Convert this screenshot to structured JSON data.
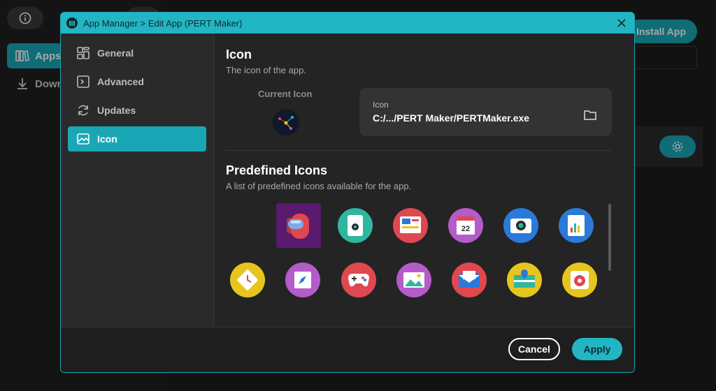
{
  "background": {
    "sidebar": [
      {
        "label": "Apps",
        "icon": "apps-icon",
        "active": true
      },
      {
        "label": "Downloads",
        "icon": "download-icon",
        "active": false
      }
    ],
    "install_label": "Install App"
  },
  "dialog": {
    "title": "App Manager > Edit App (PERT Maker)",
    "nav": [
      {
        "label": "General",
        "icon": "grid-icon",
        "active": false
      },
      {
        "label": "Advanced",
        "icon": "terminal-icon",
        "active": false
      },
      {
        "label": "Updates",
        "icon": "refresh-icon",
        "active": false
      },
      {
        "label": "Icon",
        "icon": "image-icon",
        "active": true
      }
    ],
    "icon_section": {
      "title": "Icon",
      "subtitle": "The icon of the app.",
      "current_label": "Current Icon",
      "current_icon_text": "PERT Maker",
      "field_label": "Icon",
      "field_value": "C:/.../PERT Maker/PERTMaker.exe"
    },
    "predefined": {
      "title": "Predefined Icons",
      "subtitle": "A list of predefined icons available for the app.",
      "icons": [
        {
          "name": "crewmate-icon",
          "selected": true,
          "bg": "#c9404d"
        },
        {
          "name": "camera-phone-icon",
          "selected": false,
          "bg": "#2fb6a0"
        },
        {
          "name": "dashboard-icon",
          "selected": false,
          "bg": "#e0484f"
        },
        {
          "name": "calendar-icon",
          "selected": false,
          "bg": "#b45cc9",
          "text": "22"
        },
        {
          "name": "camera-icon",
          "selected": false,
          "bg": "#2b79d8"
        },
        {
          "name": "analytics-icon",
          "selected": false,
          "bg": "#2b79d8"
        },
        {
          "name": "clock-icon",
          "selected": false,
          "bg": "#e7c51e"
        },
        {
          "name": "compass-icon",
          "selected": false,
          "bg": "#b45cc9"
        },
        {
          "name": "gamepad-icon",
          "selected": false,
          "bg": "#e0484f"
        },
        {
          "name": "gallery-icon",
          "selected": false,
          "bg": "#b45cc9"
        },
        {
          "name": "mail-icon",
          "selected": false,
          "bg": "#e0484f"
        },
        {
          "name": "map-icon",
          "selected": false,
          "bg": "#e7c51e"
        },
        {
          "name": "music-player-icon",
          "selected": false,
          "bg": "#e7c51e"
        }
      ]
    },
    "buttons": {
      "cancel": "Cancel",
      "apply": "Apply"
    }
  }
}
